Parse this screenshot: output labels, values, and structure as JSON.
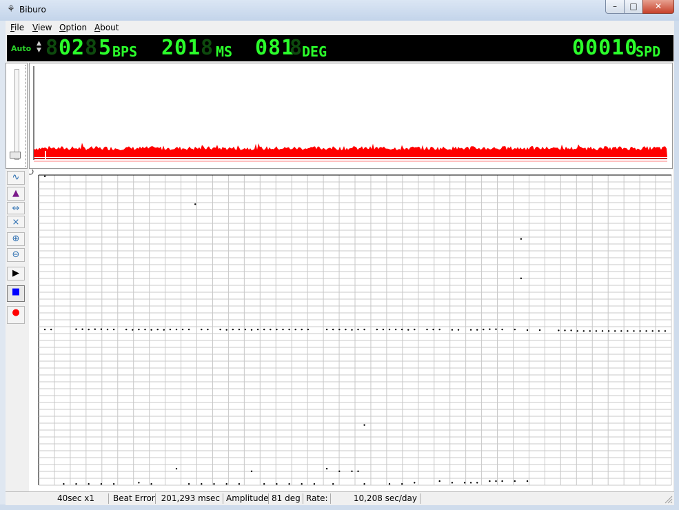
{
  "window": {
    "title": "Biburo",
    "app_icon": "app-logo-icon",
    "buttons": [
      "minimize-icon",
      "maximize-icon",
      "close-icon"
    ]
  },
  "menu": [
    {
      "label": "File",
      "mnemonic": "F"
    },
    {
      "label": "View",
      "mnemonic": "V"
    },
    {
      "label": "Option",
      "mnemonic": "O"
    },
    {
      "label": "About",
      "mnemonic": "A"
    }
  ],
  "lcd": {
    "mode": "Auto",
    "bps_value": "02",
    "bps_extra": "5",
    "bps_unit": "BPS",
    "ms_value": "201",
    "ms_unit": "MS",
    "deg_value": "081",
    "deg_unit": "DEG",
    "spd_value": "00010",
    "spd_unit": "SPD",
    "colors": {
      "on": "#2bff2b",
      "off": "#0d4a0d",
      "background": "#000000"
    }
  },
  "toolbar": {
    "buttons": [
      {
        "name": "wave-button",
        "icon": "wave-icon"
      },
      {
        "name": "weight-button",
        "icon": "weight-icon"
      },
      {
        "name": "expand-horizontal-button",
        "icon": "expand-horizontal-icon"
      },
      {
        "name": "shrink-button",
        "icon": "shrink-icon"
      },
      {
        "name": "zoom-in-button",
        "icon": "zoom-in-icon"
      },
      {
        "name": "zoom-out-button",
        "icon": "zoom-out-icon"
      },
      {
        "name": "play-button",
        "icon": "play-icon"
      },
      {
        "name": "stop-button",
        "icon": "stop-icon"
      },
      {
        "name": "record-button",
        "icon": "record-icon"
      }
    ],
    "colors": {
      "stop": "#0000ff",
      "record": "#ff0000"
    }
  },
  "waveform": {
    "color": "#ff0000"
  },
  "status": {
    "timebase": "40sec x1",
    "beat_error_label": "Beat Error:",
    "beat_error_value": "201,293 msec",
    "amplitude_label": "Amplitude:",
    "amplitude_value": "81 deg",
    "rate_label": "Rate:",
    "rate_value": "10,208 sec/day"
  },
  "chart_data": {
    "type": "scatter",
    "grid": true,
    "grid_cols": 40,
    "grid_rows": 45,
    "series": [
      {
        "values": [
          [
            0.5,
            0.502
          ],
          [
            1,
            0.502
          ],
          [
            3,
            0.503
          ],
          [
            3.5,
            0.503
          ],
          [
            4,
            0.502
          ],
          [
            4.5,
            0.503
          ],
          [
            5,
            0.503
          ],
          [
            5.5,
            0.502
          ],
          [
            6,
            0.502
          ],
          [
            7,
            0.502
          ],
          [
            7.5,
            0.501
          ],
          [
            8,
            0.502
          ],
          [
            8.5,
            0.502
          ],
          [
            9,
            0.501
          ],
          [
            9.5,
            0.502
          ],
          [
            10,
            0.501
          ],
          [
            10.5,
            0.502
          ],
          [
            11,
            0.502
          ],
          [
            11.5,
            0.502
          ],
          [
            12,
            0.502
          ],
          [
            13,
            0.502
          ],
          [
            13.5,
            0.502
          ],
          [
            14.5,
            0.502
          ],
          [
            15,
            0.501
          ],
          [
            15.5,
            0.502
          ],
          [
            16,
            0.502
          ],
          [
            16.5,
            0.502
          ],
          [
            17,
            0.501
          ],
          [
            17.5,
            0.502
          ],
          [
            18,
            0.502
          ],
          [
            18.5,
            0.502
          ],
          [
            19,
            0.502
          ],
          [
            19.5,
            0.502
          ],
          [
            20,
            0.502
          ],
          [
            20.5,
            0.502
          ],
          [
            21,
            0.502
          ],
          [
            21.5,
            0.502
          ],
          [
            23,
            0.502
          ],
          [
            23.5,
            0.502
          ],
          [
            24,
            0.502
          ],
          [
            24.5,
            0.502
          ],
          [
            25,
            0.501
          ],
          [
            25.5,
            0.502
          ],
          [
            26,
            0.502
          ],
          [
            27,
            0.502
          ],
          [
            27.5,
            0.502
          ],
          [
            28,
            0.502
          ],
          [
            28.5,
            0.502
          ],
          [
            29,
            0.502
          ],
          [
            29.5,
            0.501
          ],
          [
            30,
            0.502
          ],
          [
            31,
            0.502
          ],
          [
            31.5,
            0.502
          ],
          [
            32,
            0.502
          ],
          [
            33,
            0.501
          ],
          [
            33.5,
            0.501
          ],
          [
            34.5,
            0.501
          ],
          [
            35,
            0.501
          ],
          [
            35.5,
            0.502
          ],
          [
            36,
            0.503
          ],
          [
            36.5,
            0.503
          ],
          [
            37,
            0.502
          ],
          [
            38,
            0.502
          ],
          [
            39,
            0.5
          ],
          [
            40,
            0.5
          ],
          [
            41.5,
            0.499
          ],
          [
            42,
            0.499
          ],
          [
            42.5,
            0.499
          ],
          [
            43,
            0.497
          ],
          [
            43.5,
            0.497
          ],
          [
            44,
            0.497
          ],
          [
            44.5,
            0.497
          ],
          [
            45,
            0.497
          ],
          [
            45.5,
            0.497
          ],
          [
            46,
            0.497
          ],
          [
            46.5,
            0.497
          ],
          [
            47,
            0.497
          ],
          [
            47.5,
            0.497
          ],
          [
            48,
            0.497
          ],
          [
            48.5,
            0.497
          ],
          [
            49,
            0.497
          ],
          [
            49.5,
            0.497
          ],
          [
            50,
            0.497
          ]
        ]
      },
      {
        "values": [
          [
            0.5,
            0.996
          ],
          [
            12.5,
            0.906
          ],
          [
            38.5,
            0.794
          ],
          [
            38.5,
            0.667
          ],
          [
            26,
            0.194
          ]
        ]
      },
      {
        "values": [
          [
            2,
            0.004
          ],
          [
            3,
            0.004
          ],
          [
            4,
            0.004
          ],
          [
            5,
            0.004
          ],
          [
            6,
            0.004
          ],
          [
            8,
            0.008
          ],
          [
            9,
            0.004
          ],
          [
            11,
            0.053
          ],
          [
            12,
            0.004
          ],
          [
            13,
            0.004
          ],
          [
            14,
            0.004
          ],
          [
            15,
            0.004
          ],
          [
            16,
            0.004
          ],
          [
            17,
            0.045
          ],
          [
            18,
            0.004
          ],
          [
            19,
            0.004
          ],
          [
            20,
            0.004
          ],
          [
            21,
            0.004
          ],
          [
            22,
            0.004
          ],
          [
            23,
            0.053
          ],
          [
            23.5,
            0.004
          ],
          [
            24,
            0.045
          ],
          [
            25,
            0.045
          ],
          [
            25.5,
            0.045
          ],
          [
            26,
            0.004
          ],
          [
            28,
            0.004
          ],
          [
            29,
            0.004
          ],
          [
            30,
            0.008
          ],
          [
            32,
            0.013
          ],
          [
            33,
            0.008
          ],
          [
            34,
            0.008
          ],
          [
            34.5,
            0.008
          ],
          [
            35,
            0.008
          ],
          [
            36,
            0.013
          ],
          [
            36.5,
            0.013
          ],
          [
            37,
            0.013
          ],
          [
            38,
            0.013
          ],
          [
            39,
            0.013
          ]
        ]
      }
    ]
  }
}
